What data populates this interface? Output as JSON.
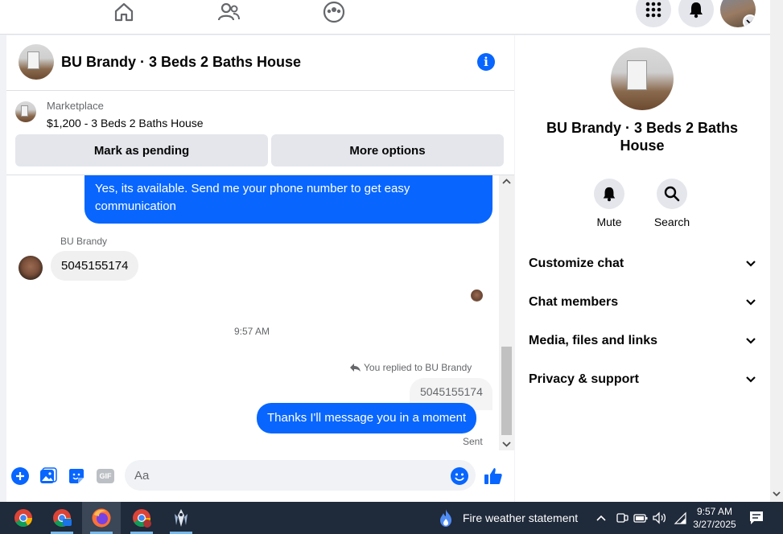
{
  "chat": {
    "title": "BU Brandy · 3 Beds 2 Baths House",
    "marketplace_label": "Marketplace",
    "listing_title": "$1,200 - 3 Beds 2 Baths House",
    "mark_pending": "Mark as pending",
    "more_options": "More options"
  },
  "messages": {
    "msg1": "Yes, its available. Send me your phone number to get easy communication",
    "sender": "BU Brandy",
    "msg2": "5045155174",
    "time": "9:57 AM",
    "reply_label": "You replied to BU Brandy",
    "quoted": "5045155174",
    "msg3": "Thanks I'll message you in a moment",
    "status": "Sent"
  },
  "composer": {
    "placeholder": "Aa",
    "gif": "GIF"
  },
  "side": {
    "name": "BU Brandy · 3 Beds 2 Baths House",
    "mute": "Mute",
    "search": "Search",
    "sections": [
      "Customize chat",
      "Chat members",
      "Media, files and links",
      "Privacy & support"
    ]
  },
  "taskbar": {
    "weather": "Fire weather statement",
    "time": "9:57 AM",
    "date": "3/27/2025"
  },
  "colors": {
    "accent": "#0866ff",
    "bubble_in": "#f0f0f0",
    "badge": "#e41e3f"
  }
}
